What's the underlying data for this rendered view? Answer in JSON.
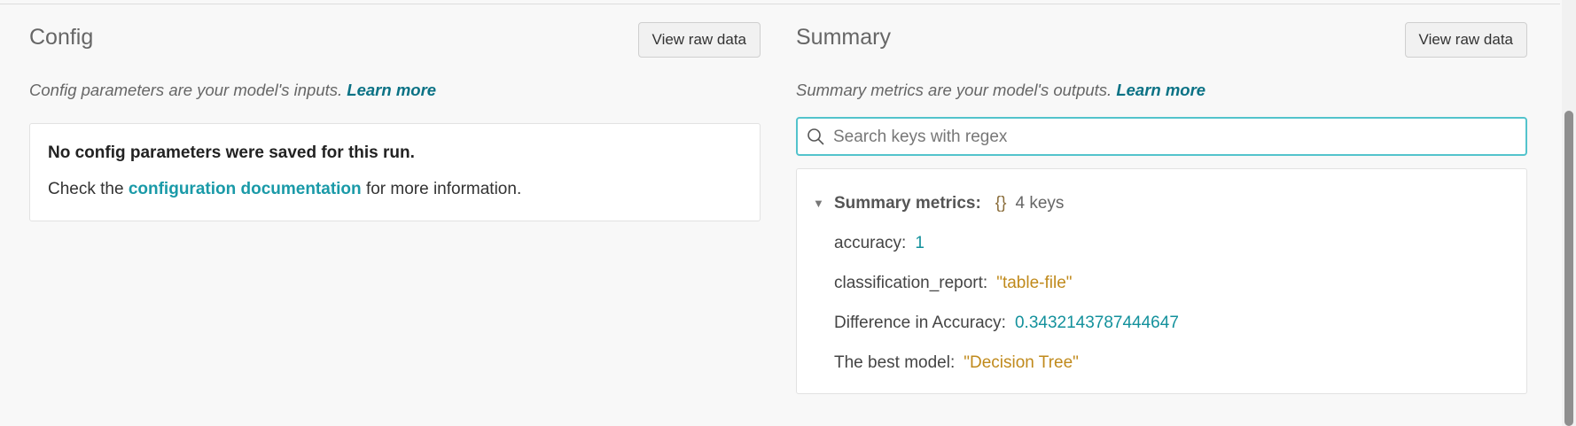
{
  "config": {
    "title": "Config",
    "raw_button": "View raw data",
    "desc_text": "Config parameters are your model's inputs.",
    "learn_more": "Learn more",
    "empty_headline": "No config parameters were saved for this run.",
    "info_prefix": "Check the",
    "doc_link": "configuration documentation",
    "info_suffix": "for more information."
  },
  "summary": {
    "title": "Summary",
    "raw_button": "View raw data",
    "desc_text": "Summary metrics are your model's outputs.",
    "learn_more": "Learn more",
    "search": {
      "placeholder": "Search keys with regex",
      "value": ""
    },
    "tree": {
      "root_label": "Summary metrics:",
      "root_braces": "{}",
      "root_count": "4 keys",
      "items": [
        {
          "key": "accuracy:",
          "value": "1",
          "kind": "number"
        },
        {
          "key": "classification_report:",
          "value": "\"table-file\"",
          "kind": "string"
        },
        {
          "key": "Difference in Accuracy:",
          "value": "0.3432143787444647",
          "kind": "number"
        },
        {
          "key": "The best model:",
          "value": "\"Decision Tree\"",
          "kind": "string"
        }
      ]
    }
  },
  "icons": {
    "search": "search-icon",
    "caret": "caret-down-icon"
  },
  "colors": {
    "accent_link": "#0b7285",
    "number_value": "#13919c",
    "string_value": "#c08a1c",
    "search_border": "#53c3cc"
  }
}
